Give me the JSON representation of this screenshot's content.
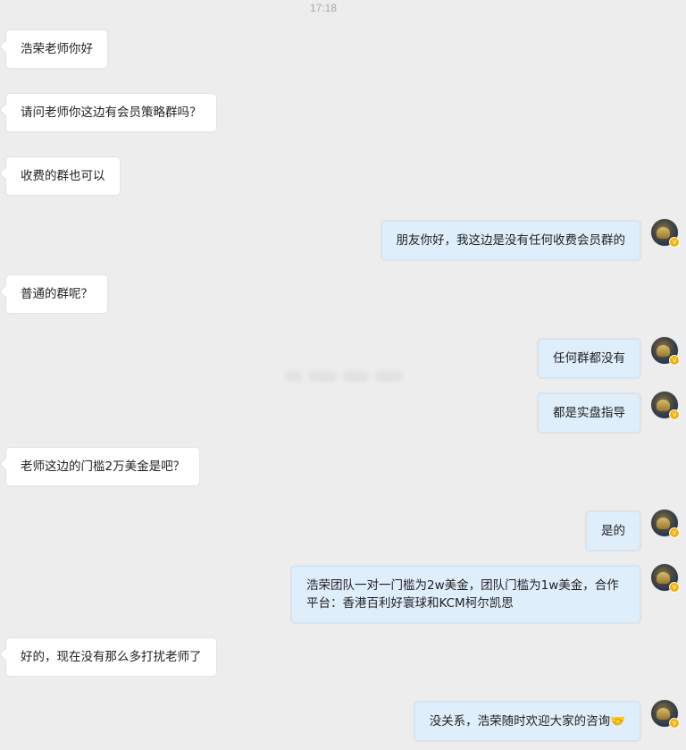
{
  "chat": {
    "timestamp": "17:18",
    "messages": [
      {
        "side": "left",
        "text": "浩荣老师你好"
      },
      {
        "side": "left",
        "text": "请问老师你这边有会员策略群吗？"
      },
      {
        "side": "left",
        "text": "收费的群也可以"
      },
      {
        "side": "right",
        "text": "朋友你好，我这边是没有任何收费会员群的"
      },
      {
        "side": "left",
        "text": "普通的群呢？"
      },
      {
        "side": "right",
        "text": "任何群都没有"
      },
      {
        "side": "right",
        "text": "都是实盘指导"
      },
      {
        "side": "left",
        "text": "老师这边的门槛2万美金是吧？"
      },
      {
        "side": "right",
        "text": "是的"
      },
      {
        "side": "right",
        "text": "浩荣团队一对一门槛为2w美金，团队门槛为1w美金，合作平台：香港百利好寰球和KCM柯尔凯思"
      },
      {
        "side": "left",
        "text": "好的，现在没有那么多打扰老师了"
      },
      {
        "side": "right",
        "text": "没关系，浩荣随时欢迎大家的咨询🤝"
      }
    ]
  },
  "avatar": {
    "badge": "v",
    "badge_color": "#f5b100"
  },
  "colors": {
    "background": "#ededed",
    "left_bubble": "#ffffff",
    "right_bubble": "#dfeefb"
  }
}
